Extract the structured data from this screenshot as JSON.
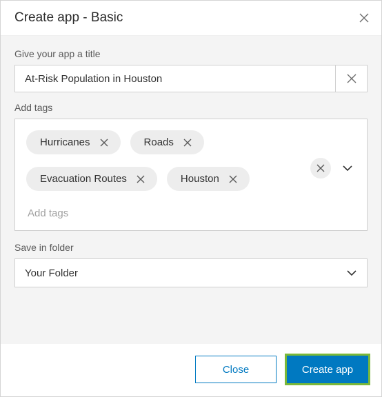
{
  "dialog": {
    "title": "Create app - Basic"
  },
  "form": {
    "title_label": "Give your app a title",
    "title_value": "At-Risk Population in Houston",
    "tags_label": "Add tags",
    "tags": [
      {
        "label": "Hurricanes"
      },
      {
        "label": "Roads"
      },
      {
        "label": "Evacuation Routes"
      },
      {
        "label": "Houston"
      }
    ],
    "tags_placeholder": "Add tags",
    "folder_label": "Save in folder",
    "folder_value": "Your Folder"
  },
  "buttons": {
    "close": "Close",
    "create": "Create app"
  }
}
